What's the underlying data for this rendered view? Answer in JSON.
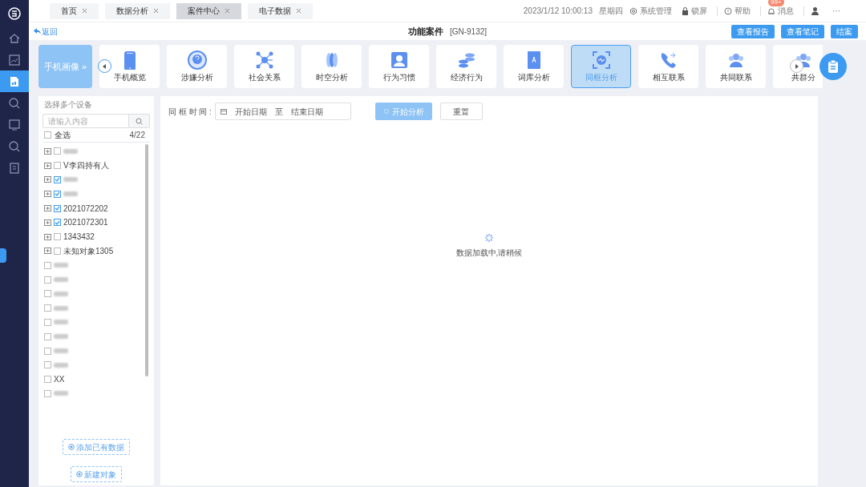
{
  "tabs": [
    {
      "label": "首页",
      "selected": false
    },
    {
      "label": "数据分析",
      "selected": false
    },
    {
      "label": "案件中心",
      "selected": true
    },
    {
      "label": "电子数据",
      "selected": false
    }
  ],
  "topbar": {
    "datetime": "2023/1/12 10:00:13",
    "weekday": "星期四",
    "admin": "系统管理",
    "lock": "锁屏",
    "help": "帮助",
    "messages": "消息",
    "badge": "99+",
    "more": "···"
  },
  "header": {
    "back": "返回",
    "title": "功能案件",
    "case_id": "[GN-9132]",
    "buttons": [
      "查看报告",
      "查看笔记",
      "结案"
    ]
  },
  "profile_card": {
    "label": "手机画像",
    "arrow": "»"
  },
  "modules": [
    {
      "label": "手机概览",
      "selected": false
    },
    {
      "label": "涉嫌分析",
      "selected": false
    },
    {
      "label": "社会关系",
      "selected": false
    },
    {
      "label": "时空分析",
      "selected": false
    },
    {
      "label": "行为习惯",
      "selected": false
    },
    {
      "label": "经济行为",
      "selected": false
    },
    {
      "label": "词库分析",
      "selected": false
    },
    {
      "label": "同框分析",
      "selected": true
    },
    {
      "label": "相互联系",
      "selected": false
    },
    {
      "label": "共同联系",
      "selected": false
    },
    {
      "label": "共群分",
      "selected": false
    }
  ],
  "devices": {
    "title": "选择多个设备",
    "search_placeholder": "请输入内容",
    "select_all": {
      "label": "全选",
      "checked": false
    },
    "count": "4/22",
    "items": [
      {
        "eye": true,
        "checked": false
      },
      {
        "eye": true,
        "checked": false,
        "label": "V李四持有人"
      },
      {
        "eye": true,
        "checked": true
      },
      {
        "eye": true,
        "checked": true
      },
      {
        "eye": true,
        "checked": true,
        "label": "2021072202"
      },
      {
        "eye": true,
        "checked": true,
        "label": "2021072301"
      },
      {
        "eye": true,
        "checked": false,
        "label": "1343432"
      },
      {
        "eye": true,
        "checked": false,
        "label": "未知对象1305"
      },
      {
        "eye": false,
        "checked": false
      },
      {
        "eye": false,
        "checked": false
      },
      {
        "eye": false,
        "checked": false
      },
      {
        "eye": false,
        "checked": false
      },
      {
        "eye": false,
        "checked": false
      },
      {
        "eye": false,
        "checked": false
      },
      {
        "eye": false,
        "checked": false
      },
      {
        "eye": false,
        "checked": false
      },
      {
        "eye": false,
        "checked": false,
        "label": "XX"
      },
      {
        "eye": false,
        "checked": false
      }
    ],
    "add_existing": "添加已有数据",
    "new_object": "新建对象"
  },
  "filter": {
    "label": "同 框 时 间 :",
    "start_placeholder": "开始日期",
    "separator": "至",
    "end_placeholder": "结束日期",
    "analyze": "开始分析",
    "reset": "重置"
  },
  "loading": {
    "message": "数据加载中,请稍候"
  }
}
